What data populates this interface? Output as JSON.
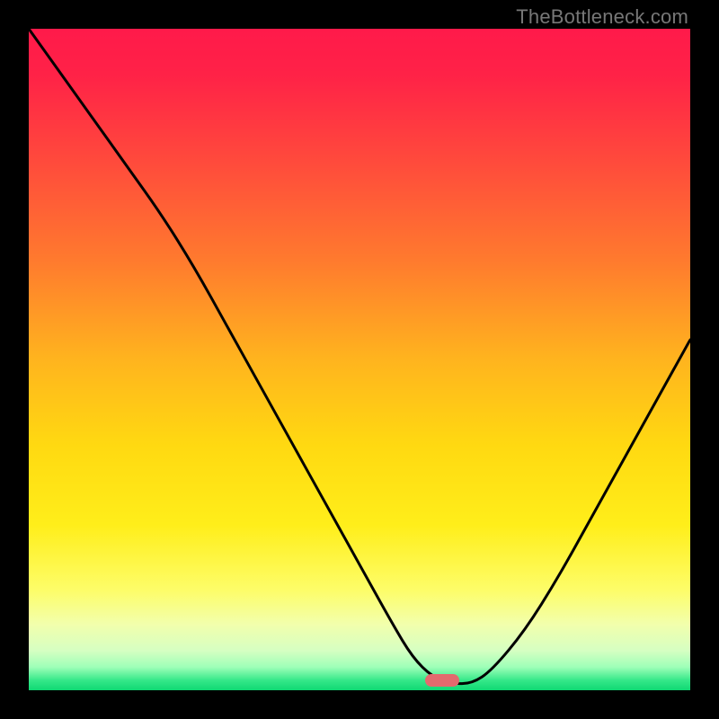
{
  "watermark": "TheBottleneck.com",
  "colors": {
    "background": "#000000",
    "gradient_stops": [
      {
        "offset": 0.0,
        "color": "#ff1a4a"
      },
      {
        "offset": 0.07,
        "color": "#ff2247"
      },
      {
        "offset": 0.2,
        "color": "#ff4a3c"
      },
      {
        "offset": 0.35,
        "color": "#ff7a2e"
      },
      {
        "offset": 0.5,
        "color": "#ffb41e"
      },
      {
        "offset": 0.63,
        "color": "#ffd911"
      },
      {
        "offset": 0.75,
        "color": "#ffee1a"
      },
      {
        "offset": 0.85,
        "color": "#fdfd6a"
      },
      {
        "offset": 0.9,
        "color": "#f2ffac"
      },
      {
        "offset": 0.94,
        "color": "#d6ffc2"
      },
      {
        "offset": 0.965,
        "color": "#9effb8"
      },
      {
        "offset": 0.985,
        "color": "#35e889"
      },
      {
        "offset": 1.0,
        "color": "#0fd873"
      }
    ],
    "curve_stroke": "#000000",
    "marker_fill": "#e36a6e"
  },
  "marker": {
    "x_frac": 0.625,
    "y_frac": 0.985
  },
  "chart_data": {
    "type": "line",
    "title": "",
    "xlabel": "",
    "ylabel": "",
    "xlim": [
      0,
      1
    ],
    "ylim": [
      0,
      1
    ],
    "series": [
      {
        "name": "bottleneck-curve",
        "x": [
          0.0,
          0.05,
          0.1,
          0.15,
          0.2,
          0.25,
          0.3,
          0.35,
          0.4,
          0.45,
          0.5,
          0.55,
          0.58,
          0.61,
          0.64,
          0.67,
          0.7,
          0.75,
          0.8,
          0.85,
          0.9,
          0.95,
          1.0
        ],
        "y": [
          1.0,
          0.93,
          0.86,
          0.79,
          0.72,
          0.64,
          0.55,
          0.46,
          0.37,
          0.28,
          0.19,
          0.1,
          0.05,
          0.02,
          0.01,
          0.01,
          0.03,
          0.09,
          0.17,
          0.26,
          0.35,
          0.44,
          0.53
        ]
      }
    ],
    "annotations": [
      {
        "type": "marker",
        "x": 0.625,
        "y": 0.015,
        "label": "optimal-point"
      }
    ]
  }
}
